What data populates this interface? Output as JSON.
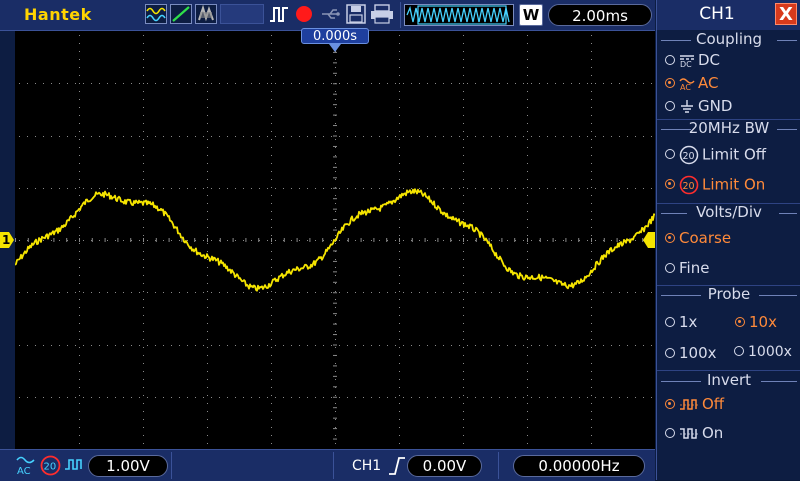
{
  "header": {
    "brand": "Hantek",
    "timebase": "2.00ms",
    "window_letter": "W",
    "trigger_time": "0.000s"
  },
  "footer": {
    "ch_volts": "1.00V",
    "trigger_source": "CH1",
    "trigger_level": "0.00V",
    "frequency": "0.00000Hz",
    "coupling_icon_label": "AC",
    "bw_icon_label": "20"
  },
  "marker": {
    "channel_label": "1"
  },
  "panel": {
    "title": "CH1",
    "close": "X",
    "coupling": {
      "title": "Coupling",
      "options": [
        {
          "label": "DC",
          "selected": false
        },
        {
          "label": "AC",
          "selected": true
        },
        {
          "label": "GND",
          "selected": false
        }
      ]
    },
    "bandwidth": {
      "title": "20MHz BW",
      "options": [
        {
          "label": "Limit Off",
          "selected": false
        },
        {
          "label": "Limit On",
          "selected": true
        }
      ]
    },
    "volts_div": {
      "title": "Volts/Div",
      "options": [
        {
          "label": "Coarse",
          "selected": true
        },
        {
          "label": "Fine",
          "selected": false
        }
      ]
    },
    "probe": {
      "title": "Probe",
      "options": [
        {
          "label": "1x",
          "selected": false
        },
        {
          "label": "10x",
          "selected": true
        },
        {
          "label": "100x",
          "selected": false
        },
        {
          "label": "1000x",
          "selected": false
        }
      ]
    },
    "invert": {
      "title": "Invert",
      "options": [
        {
          "label": "Off",
          "selected": true
        },
        {
          "label": "On",
          "selected": false
        }
      ]
    }
  },
  "colors": {
    "trace": "#f5e400",
    "selected": "#ff8a3a",
    "panel_bg": "#0d1d42",
    "bar_bg": "#1a2d66"
  }
}
